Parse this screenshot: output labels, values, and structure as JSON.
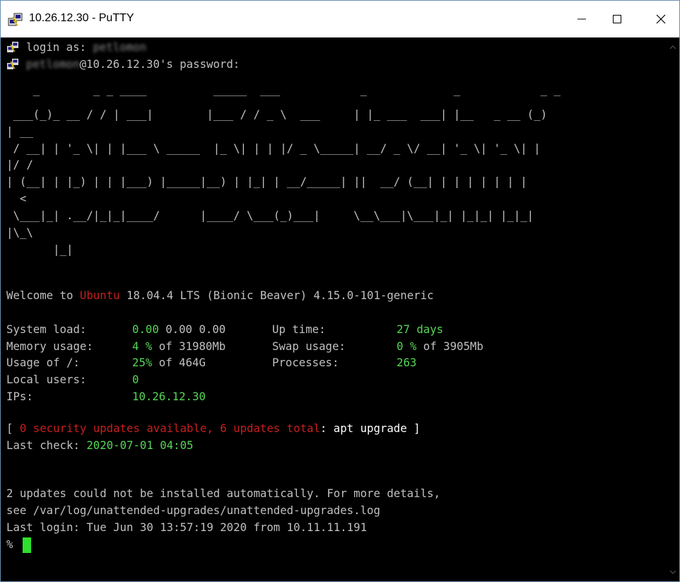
{
  "window": {
    "title": "10.26.12.30 - PuTTY"
  },
  "session": {
    "login_prompt": "login as:",
    "login_user": "petlomon",
    "password_user": "petlomon",
    "password_prompt": "@10.26.12.30's password:"
  },
  "banner_art": [
    "    _        _ _ ____          _____  ___            _             _            _ _",
    " ___(_)_ __ / / | ___|        |___ / / _ \\  ___     | |_ ___  ___| |__   _ __ (_)",
    "| __",
    " / __| | '_ \\| | |___ \\ _____  |_ \\| | | |/ _ \\_____| __/ _ \\/ __| '_ \\| '_ \\| |",
    "|/ /",
    "| (__| | |_) | | |___) |_____|__) | |_| | __/_____| ||  __/ (__| | | | | | | |",
    "  <",
    " \\___|_| .__/|_|_|____/      |____/ \\___(_)___|     \\__\\___|\\___|_| |_|_| |_|_|",
    "|\\_\\",
    "       |_|"
  ],
  "welcome": {
    "prefix": "Welcome to ",
    "distro": "Ubuntu",
    "suffix": " 18.04.4 LTS (Bionic Beaver) 4.15.0-101-generic"
  },
  "stats": {
    "system_load_label": "System load:",
    "system_load_value": "0.00",
    "system_load_rest": " 0.00 0.00",
    "up_time_label": "Up time:",
    "up_time_value": "27 days",
    "memory_label": "Memory usage:",
    "memory_value": "4 %",
    "memory_rest": " of 31980Mb",
    "swap_label": "Swap usage:",
    "swap_value": "0 %",
    "swap_rest": " of 3905Mb",
    "usage_label": "Usage of /:",
    "usage_value": "25%",
    "usage_rest": " of 464G",
    "processes_label": "Processes:",
    "processes_value": "263",
    "users_label": "Local users:",
    "users_value": "0",
    "ips_label": "IPs:",
    "ips_value": "10.26.12.30"
  },
  "updates": {
    "open_bracket": "[ ",
    "security": "0 security updates available, 6 updates total",
    "cmd": ": apt upgrade ]",
    "last_check_label": "Last check: ",
    "last_check_value": "2020-07-01 04:05"
  },
  "messages": {
    "line1": "2 updates could not be installed automatically. For more details,",
    "line2": "see /var/log/unattended-upgrades/unattended-upgrades.log",
    "line3": "Last login: Tue Jun 30 13:57:19 2020 from 10.11.11.191",
    "prompt": "%"
  },
  "colors": {
    "terminal_bg": "#000000",
    "text": "#c0c0c0",
    "green": "#55d655",
    "red": "#c81e1e",
    "cursor": "#2de02d"
  }
}
